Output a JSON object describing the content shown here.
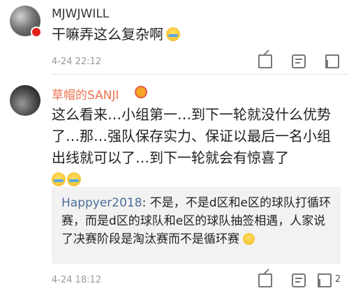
{
  "comments": [
    {
      "username": "MJWJWILL",
      "text": "干嘛弄这么复杂啊",
      "emoji": "crying-laugh",
      "time": "4-24 22:12",
      "like_count": ""
    },
    {
      "username": "草帽的SANJI",
      "text": "这么看来…小组第一…到下一轮就没什么优势了…那…强队保存实力、保证以最后一名小组出线就可以了…到下一轮就会有惊喜了",
      "emojis": [
        "crying-laugh",
        "crying-laugh"
      ],
      "time": "4-24 18:12",
      "like_count": "2",
      "reply": {
        "user": "Happyer2018",
        "separator": ": ",
        "text": "不是，不是d区和e区的球队打循环赛，而是d区的球队和e区的球队抽签相遇，人家说了决赛阶段是淘汰赛而不是循环赛"
      }
    }
  ],
  "icons": {
    "share": "share-icon",
    "reply": "comment-icon",
    "like": "thumbs-up-icon",
    "verified": "verified-badge-icon",
    "vip": "vip-crown-icon"
  },
  "colors": {
    "username_vip": "#eb7350",
    "reply_user": "#4a6d99",
    "time": "#999999",
    "reply_bg": "#f2f2f2"
  }
}
